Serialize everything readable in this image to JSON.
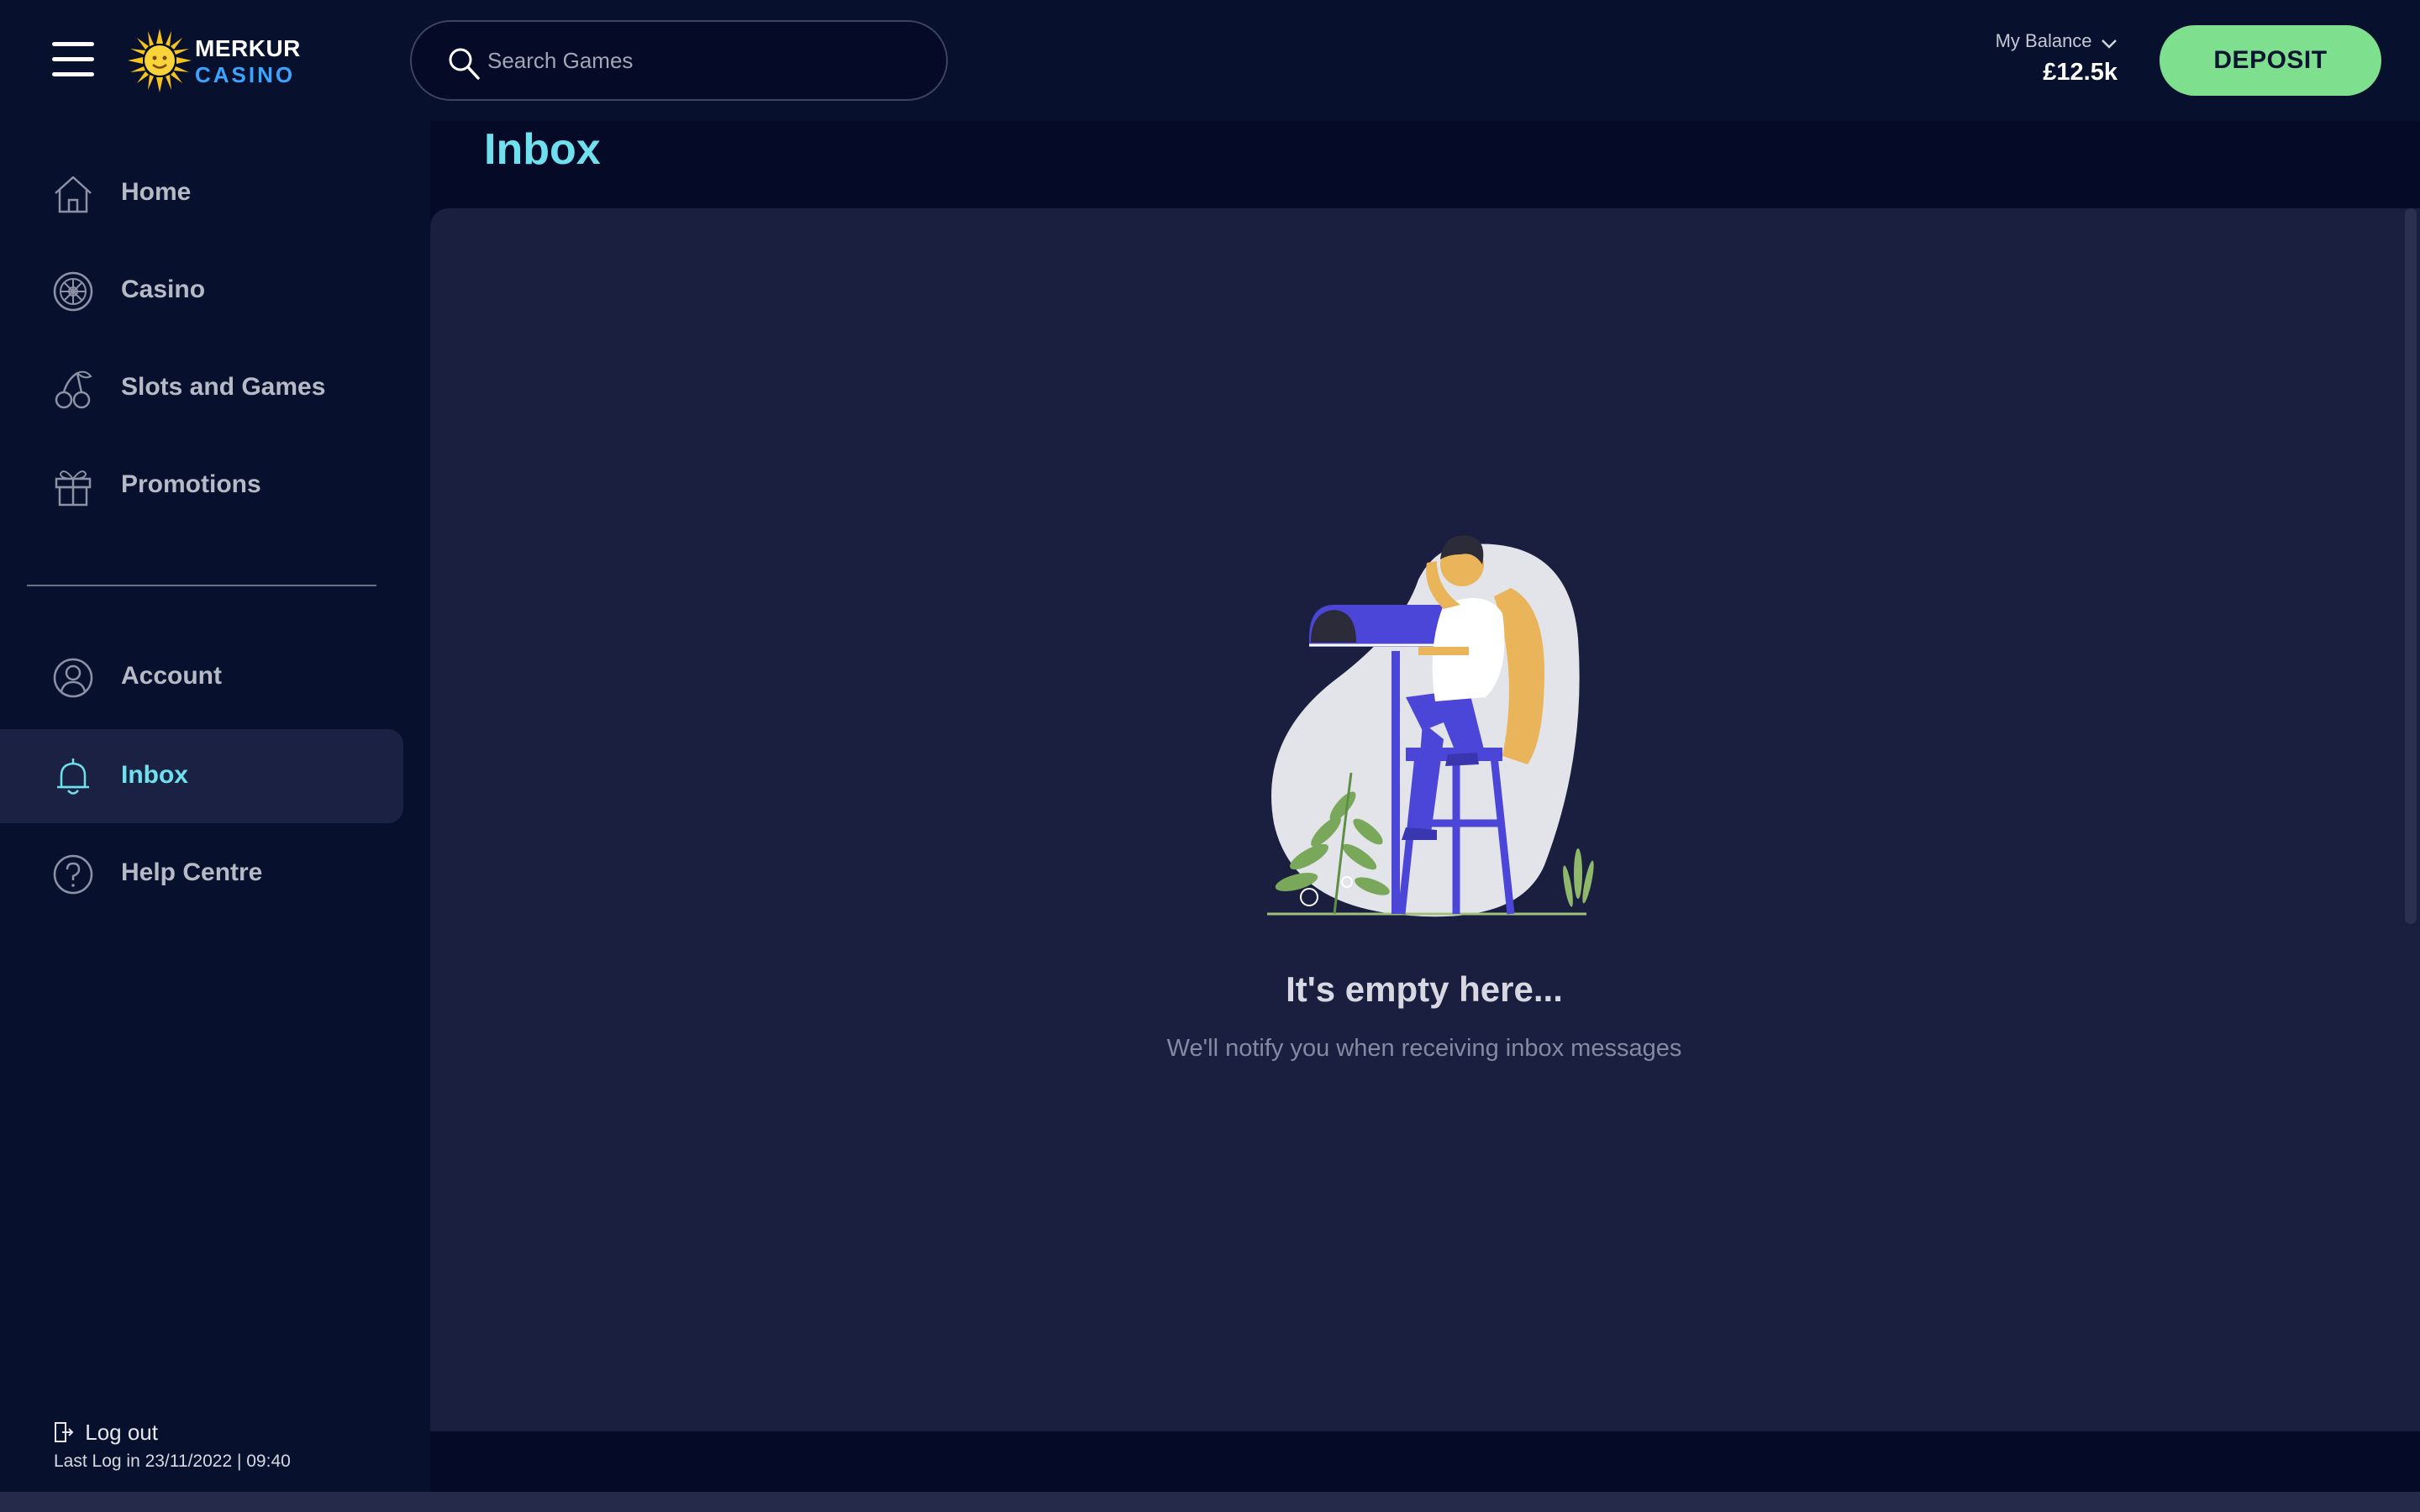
{
  "header": {
    "menu_icon": "hamburger-menu-icon",
    "logo": {
      "top": "MERKUR",
      "bottom": "CASINO",
      "icon": "sun-logo-icon"
    },
    "search": {
      "placeholder": "Search Games",
      "icon": "search-icon"
    },
    "balance": {
      "label": "My Balance",
      "value": "£12.5k",
      "icon": "chevron-down-icon"
    },
    "deposit_label": "DEPOSIT"
  },
  "sidebar": {
    "items": [
      {
        "label": "Home",
        "icon": "home-icon"
      },
      {
        "label": "Casino",
        "icon": "roulette-wheel-icon"
      },
      {
        "label": "Slots and Games",
        "icon": "cherries-icon"
      },
      {
        "label": "Promotions",
        "icon": "gift-icon"
      },
      {
        "label": "Account",
        "icon": "user-icon"
      },
      {
        "label": "Inbox",
        "icon": "bell-icon",
        "active": true
      },
      {
        "label": "Help Centre",
        "icon": "question-icon"
      }
    ],
    "logout_label": "Log out",
    "last_login": "Last Log in 23/11/2022 | 09:40"
  },
  "main": {
    "title": "Inbox",
    "empty_title": "It's empty here...",
    "empty_subtitle": "We'll notify you when receiving inbox messages"
  },
  "colors": {
    "background": "#050a26",
    "panel": "#1b1f3f",
    "accent": "#6fe0ee",
    "deposit": "#7ee08f",
    "logo_blue": "#3aa4ff"
  }
}
